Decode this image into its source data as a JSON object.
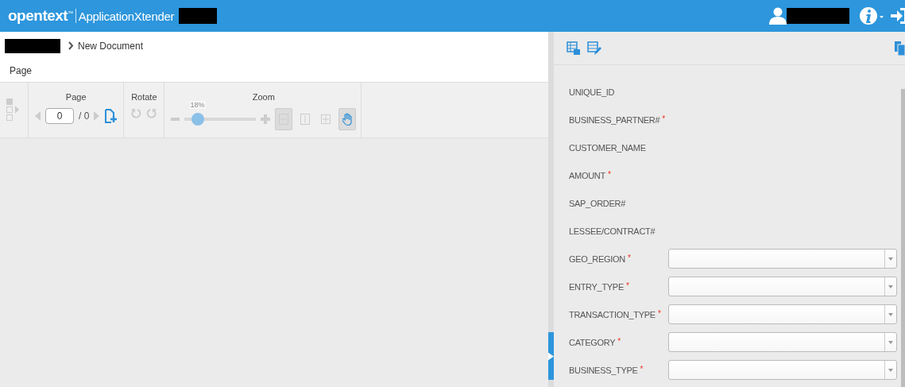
{
  "header": {
    "brand": "opentext",
    "brand_mark": "™",
    "product": "ApplicationXtender"
  },
  "breadcrumb": {
    "current": "New Document"
  },
  "tabs": [
    {
      "label": "Page",
      "selected": true
    }
  ],
  "toolbar": {
    "page_group": {
      "title": "Page",
      "page_value": "0",
      "page_total": "/ 0"
    },
    "rotate_group": {
      "title": "Rotate"
    },
    "zoom_group": {
      "title": "Zoom",
      "reading": "18%",
      "level": 0.18,
      "modes": [
        {
          "kind": "fit-width",
          "selected": true
        },
        {
          "kind": "fit-height",
          "selected": false
        },
        {
          "kind": "fit-page",
          "selected": false
        },
        {
          "kind": "pan",
          "selected": true
        }
      ]
    }
  },
  "fields": [
    {
      "label": "UNIQUE_ID",
      "kind": "readonly"
    },
    {
      "label": "BUSINESS_PARTNER#",
      "required_mark": "*",
      "kind": "readonly"
    },
    {
      "label": "CUSTOMER_NAME",
      "kind": "readonly"
    },
    {
      "label": "AMOUNT",
      "required_mark": "*",
      "kind": "readonly"
    },
    {
      "label": "SAP_ORDER#",
      "kind": "readonly"
    },
    {
      "label": "LESSEE/CONTRACT#",
      "kind": "readonly"
    },
    {
      "label": "GEO_REGION",
      "required_mark": "*",
      "kind": "dropdown"
    },
    {
      "label": "ENTRY_TYPE",
      "required_mark": "*",
      "kind": "dropdown"
    },
    {
      "label": "TRANSACTION_TYPE",
      "required_mark": "*",
      "kind": "dropdown"
    },
    {
      "label": "CATEGORY",
      "required_mark": "*",
      "kind": "dropdown"
    },
    {
      "label": "BUSINESS_TYPE",
      "required_mark": "*",
      "kind": "dropdown"
    }
  ]
}
